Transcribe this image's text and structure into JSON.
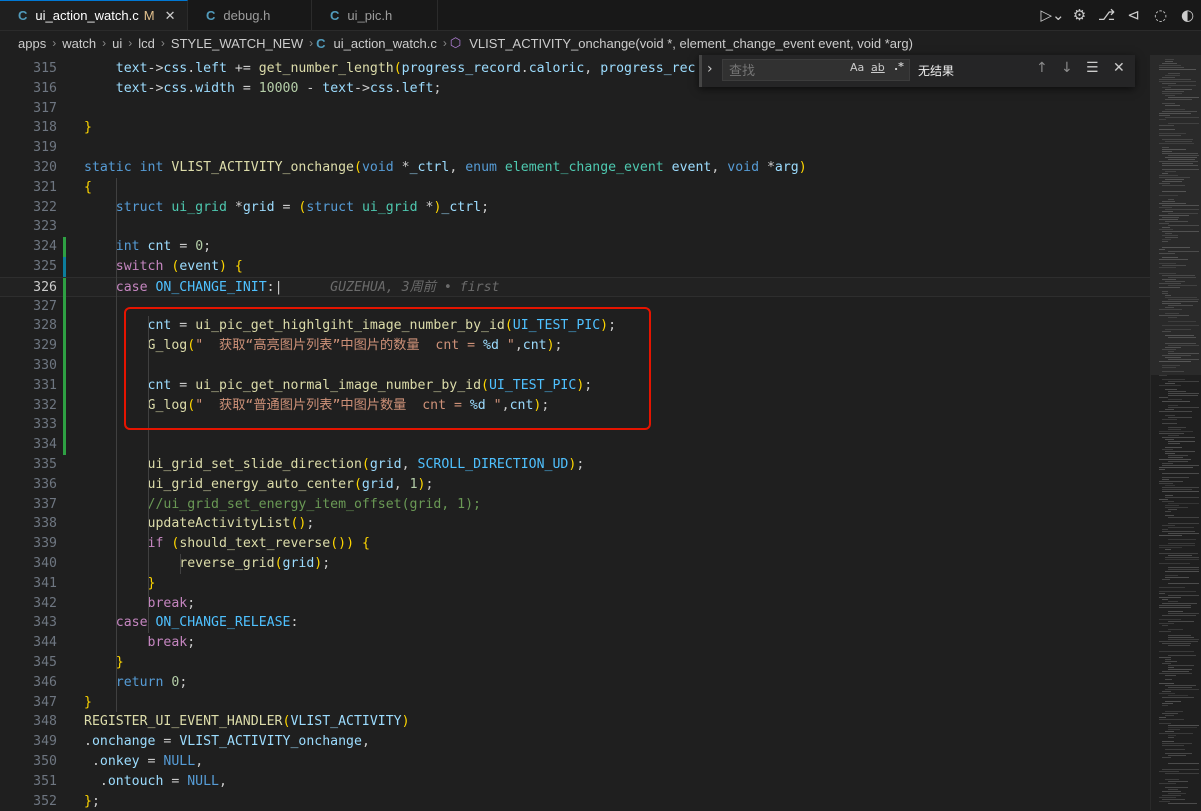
{
  "tabs": [
    {
      "icon": "C",
      "name": "ui_action_watch.c",
      "modified": "M",
      "close": "✕",
      "active": true
    },
    {
      "icon": "C",
      "name": "debug.h",
      "active": false
    },
    {
      "icon": "C",
      "name": "ui_pic.h",
      "active": false
    }
  ],
  "breadcrumb": {
    "items": [
      "apps",
      "watch",
      "ui",
      "lcd",
      "STYLE_WATCH_NEW",
      "ui_action_watch.c",
      "VLIST_ACTIVITY_onchange(void *, element_change_event event, void *arg)"
    ]
  },
  "find": {
    "placeholder": "查找",
    "opt_case": "Aa",
    "opt_word": "ab",
    "opt_regex": ".*",
    "result": "无结果"
  },
  "editor": {
    "blame": "GUZEHUA, 3周前 • first",
    "line_numbers": [
      "315",
      "316",
      "317",
      "318",
      "319",
      "320",
      "321",
      "322",
      "323",
      "324",
      "325",
      "326",
      "327",
      "328",
      "329",
      "330",
      "331",
      "332",
      "333",
      "334",
      "335",
      "336",
      "337",
      "338",
      "339",
      "340",
      "341",
      "342",
      "343",
      "344",
      "345",
      "346",
      "347",
      "348",
      "349",
      "350",
      "351",
      "352"
    ],
    "current_line": "326",
    "lines": [
      "    text->css.left += get_number_length(progress_record.caloric, progress_rec",
      "    text->css.width = 10000 - text->css.left;",
      "",
      "}",
      "",
      "static int VLIST_ACTIVITY_onchange(void *_ctrl, enum element_change_event event, void *arg)",
      "{",
      "    struct ui_grid *grid = (struct ui_grid *)_ctrl;",
      "",
      "    int cnt = 0;",
      "    switch (event) {",
      "    case ON_CHANGE_INIT:",
      "",
      "        cnt = ui_pic_get_highlgiht_image_number_by_id(UI_TEST_PIC);",
      "        G_log(\"  获取“高亮图片列表”中图片的数量  cnt = %d \",cnt);",
      "",
      "        cnt = ui_pic_get_normal_image_number_by_id(UI_TEST_PIC);",
      "        G_log(\"  获取“普通图片列表”中图片数量  cnt = %d \",cnt);",
      "",
      "",
      "        ui_grid_set_slide_direction(grid, SCROLL_DIRECTION_UD);",
      "        ui_grid_energy_auto_center(grid, 1);",
      "        //ui_grid_set_energy_item_offset(grid, 1);",
      "        updateActivityList();",
      "        if (should_text_reverse()) {",
      "            reverse_grid(grid);",
      "        }",
      "        break;",
      "    case ON_CHANGE_RELEASE:",
      "        break;",
      "    }",
      "    return 0;",
      "}",
      "REGISTER_UI_EVENT_HANDLER(VLIST_ACTIVITY)",
      ".onchange = VLIST_ACTIVITY_onchange,",
      " .onkey = NULL,",
      "  .ontouch = NULL,",
      "};"
    ]
  }
}
